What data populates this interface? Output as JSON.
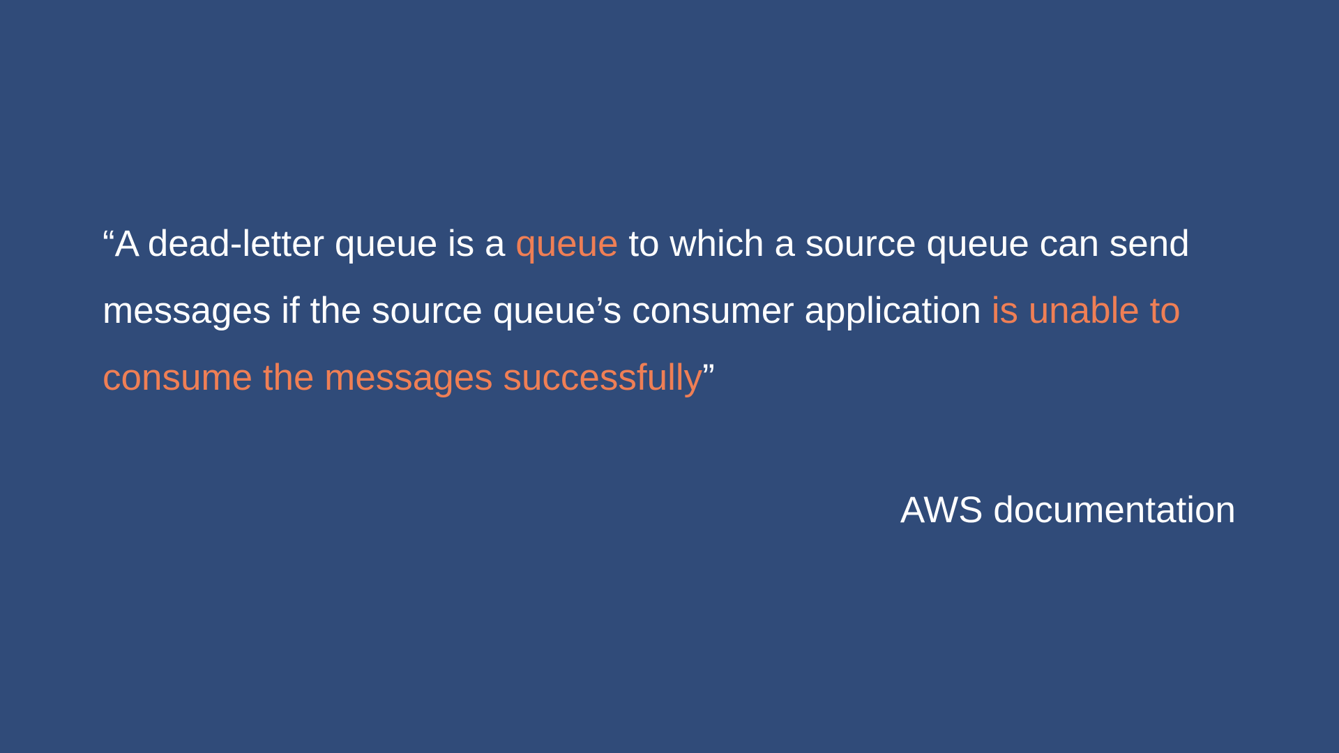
{
  "quote": {
    "open_mark": "“",
    "part1": "A dead-letter queue is a ",
    "highlight1": "queue",
    "part2": " to which a source queue can send messages if the source queue’s consumer application ",
    "highlight2": "is unable to consume the messages successfully",
    "close_mark": "”"
  },
  "attribution": "AWS documentation",
  "colors": {
    "background": "#304b79",
    "text": "#ffffff",
    "highlight": "#ef7f55"
  }
}
